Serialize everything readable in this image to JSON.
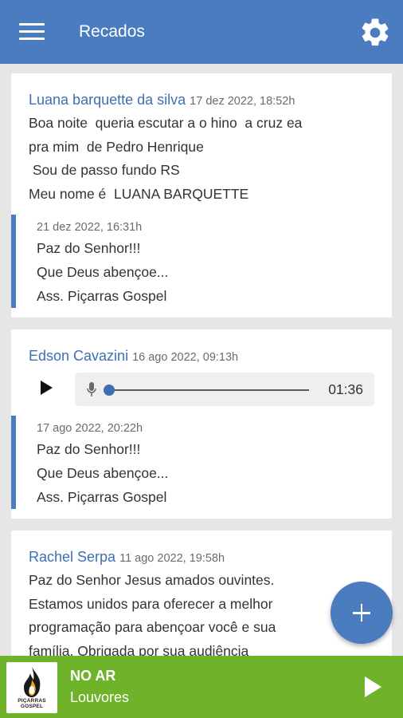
{
  "appbar": {
    "title": "Recados",
    "menu_icon": "hamburger-menu-icon",
    "settings_icon": "gear-icon",
    "color": "#4a7cbf"
  },
  "messages": [
    {
      "author": "Luana barquette da silva",
      "date": "17 dez 2022, 18:52h",
      "text": "Boa noite  queria escutar a o hino  a cruz ea\npra mim  de Pedro Henrique\n Sou de passo fundo RS\nMeu nome é  LUANA BARQUETTE",
      "reply": {
        "date": "21 dez 2022, 16:31h",
        "text": "Paz do Senhor!!!\nQue Deus abençoe...\nAss. Piçarras Gospel"
      }
    },
    {
      "author": "Edson Cavazini",
      "date": "16 ago 2022, 09:13h",
      "audio": {
        "duration": "01:36",
        "progress": 0
      },
      "reply": {
        "date": "17 ago 2022, 20:22h",
        "text": "Paz do Senhor!!!\nQue Deus abençoe...\nAss. Piçarras Gospel"
      }
    },
    {
      "author": "Rachel Serpa",
      "date": "11 ago 2022, 19:58h",
      "text": "Paz do Senhor Jesus amados ouvintes.\nEstamos unidos para oferecer a melhor\nprogramação para abençoar você e sua\nfamília. Obrigada por sua audiência"
    }
  ],
  "fab": {
    "icon": "plus-icon"
  },
  "player": {
    "logo_text": "PIÇARRAS GOSPEL",
    "status": "NO AR",
    "program": "Louvores",
    "play_icon": "play-icon",
    "color": "#6fb32b"
  }
}
